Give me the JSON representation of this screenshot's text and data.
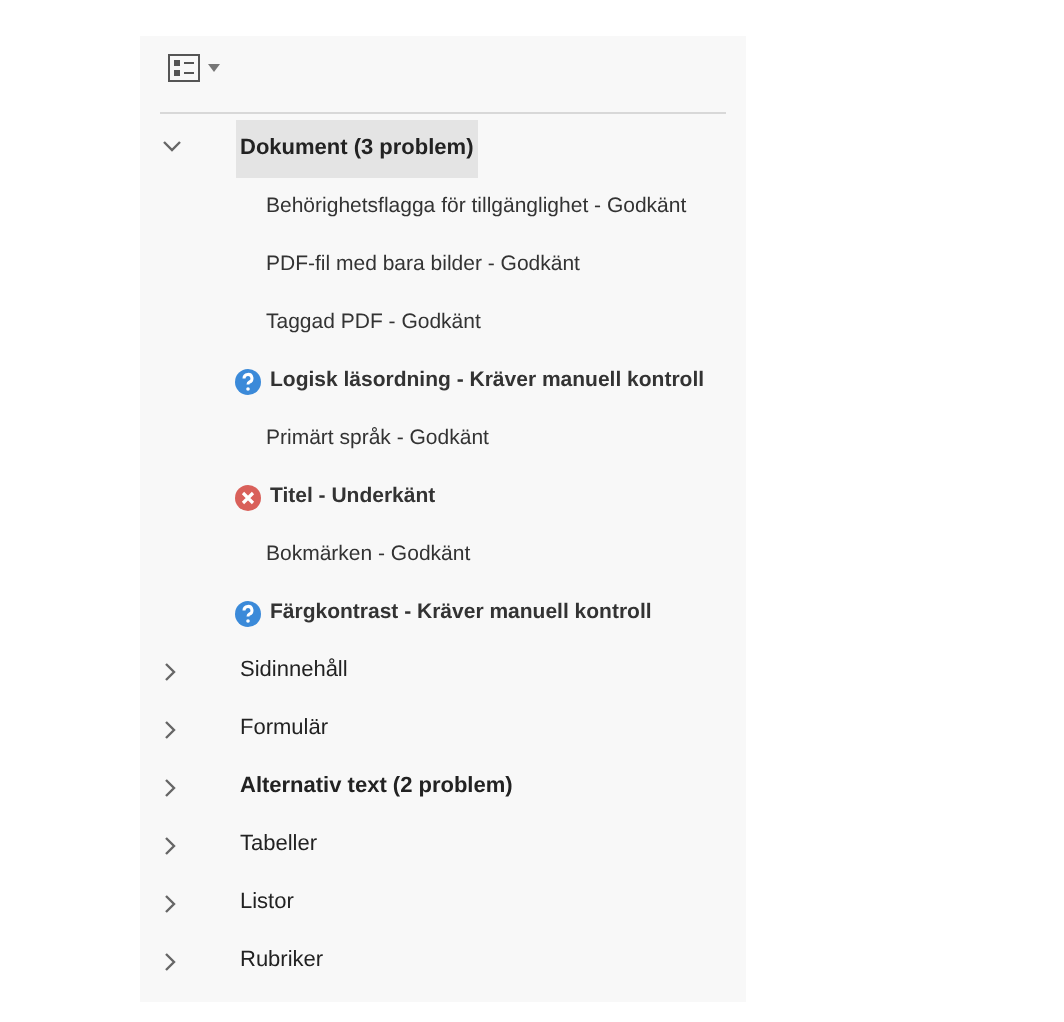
{
  "categories": [
    {
      "label": "Dokument (3 problem)",
      "bold": true,
      "expanded": true,
      "selected": true,
      "children": [
        {
          "label": "Behörighetsflagga för tillgänglighet - Godkänt",
          "kind": "pass"
        },
        {
          "label": "PDF-fil med bara bilder - Godkänt",
          "kind": "pass"
        },
        {
          "label": "Taggad PDF - Godkänt",
          "kind": "pass"
        },
        {
          "label": "Logisk läsordning - Kräver manuell kontroll",
          "kind": "manual"
        },
        {
          "label": "Primärt språk - Godkänt",
          "kind": "pass"
        },
        {
          "label": "Titel - Underkänt",
          "kind": "fail"
        },
        {
          "label": "Bokmärken - Godkänt",
          "kind": "pass"
        },
        {
          "label": "Färgkontrast - Kräver manuell kontroll",
          "kind": "manual"
        }
      ]
    },
    {
      "label": "Sidinnehåll",
      "bold": false,
      "expanded": false,
      "selected": false
    },
    {
      "label": "Formulär",
      "bold": false,
      "expanded": false,
      "selected": false
    },
    {
      "label": "Alternativ text (2 problem)",
      "bold": true,
      "expanded": false,
      "selected": false
    },
    {
      "label": "Tabeller",
      "bold": false,
      "expanded": false,
      "selected": false
    },
    {
      "label": "Listor",
      "bold": false,
      "expanded": false,
      "selected": false
    },
    {
      "label": "Rubriker",
      "bold": false,
      "expanded": false,
      "selected": false
    }
  ]
}
